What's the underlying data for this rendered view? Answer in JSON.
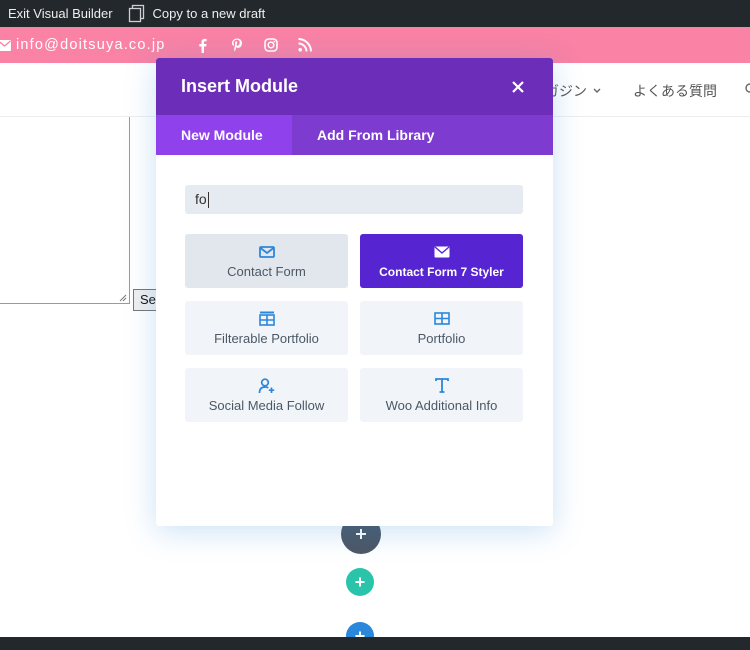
{
  "adminbar": {
    "exit_label": "Exit Visual Builder",
    "copy_label": "Copy to a new draft"
  },
  "topbar": {
    "email": "info@doitsuya.co.jp",
    "social_icons": [
      "facebook-icon",
      "pinterest-icon",
      "instagram-icon",
      "rss-icon"
    ],
    "bg_color": "#f982a5"
  },
  "header": {
    "nav": {
      "magazine": "ガジン",
      "faq": "よくある質問"
    }
  },
  "page": {
    "send_button": "Se"
  },
  "modal": {
    "title": "Insert Module",
    "tabs": [
      {
        "label": "New Module",
        "active": true
      },
      {
        "label": "Add From Library",
        "active": false
      }
    ],
    "search_value": "fo",
    "modules": [
      {
        "label": "Contact Form",
        "icon": "envelope-icon",
        "state": "hover"
      },
      {
        "label": "Contact Form 7 Styler",
        "icon": "envelope-icon",
        "state": "active"
      },
      {
        "label": "Filterable Portfolio",
        "icon": "filterable-grid-icon",
        "state": "normal"
      },
      {
        "label": "Portfolio",
        "icon": "grid-icon",
        "state": "normal"
      },
      {
        "label": "Social Media Follow",
        "icon": "user-plus-icon",
        "state": "normal"
      },
      {
        "label": "Woo Additional Info",
        "icon": "text-t-icon",
        "state": "normal"
      }
    ],
    "header_color": "#6c2eb9",
    "tab_bar_color": "#7d3bcf",
    "active_tab_color": "#8f42ec",
    "active_module_color": "#5624d0"
  }
}
